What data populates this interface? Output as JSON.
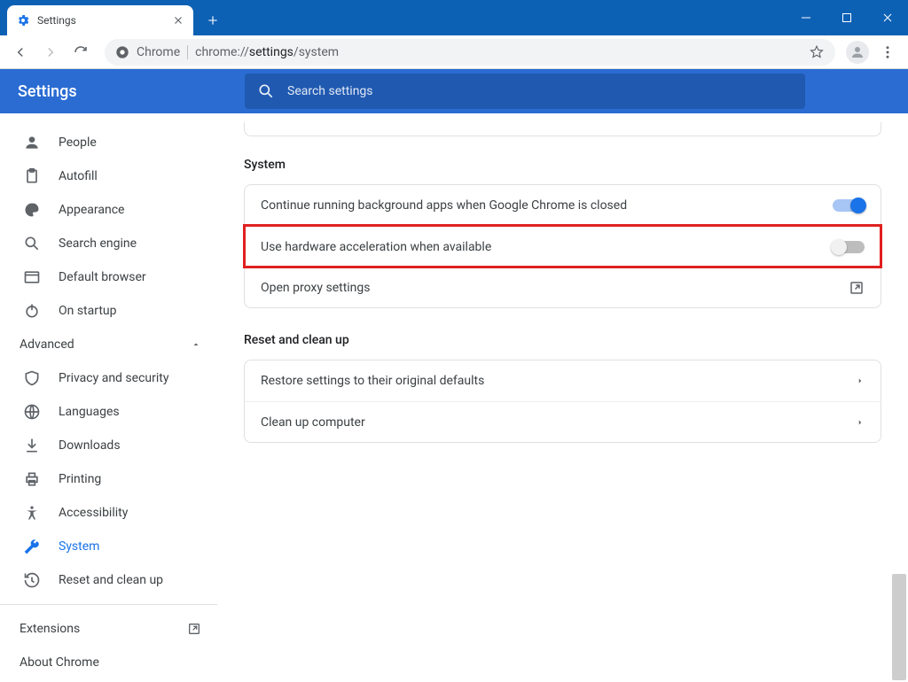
{
  "tab": {
    "title": "Settings"
  },
  "omnibox": {
    "chip": "Chrome",
    "prefix": "chrome://",
    "bold": "settings",
    "suffix": "/system"
  },
  "header": {
    "title": "Settings",
    "search_placeholder": "Search settings"
  },
  "sidebar": {
    "items": [
      {
        "icon": "person",
        "label": "People"
      },
      {
        "icon": "clipboard",
        "label": "Autofill"
      },
      {
        "icon": "palette",
        "label": "Appearance"
      },
      {
        "icon": "search",
        "label": "Search engine"
      },
      {
        "icon": "window",
        "label": "Default browser"
      },
      {
        "icon": "power",
        "label": "On startup"
      }
    ],
    "advanced_label": "Advanced",
    "adv_items": [
      {
        "icon": "shield",
        "label": "Privacy and security"
      },
      {
        "icon": "globe",
        "label": "Languages"
      },
      {
        "icon": "download",
        "label": "Downloads"
      },
      {
        "icon": "printer",
        "label": "Printing"
      },
      {
        "icon": "accessibility",
        "label": "Accessibility"
      },
      {
        "icon": "wrench",
        "label": "System",
        "selected": true
      },
      {
        "icon": "restore",
        "label": "Reset and clean up"
      }
    ],
    "extensions": "Extensions",
    "about": "About Chrome"
  },
  "main": {
    "system_title": "System",
    "rows": {
      "bg_apps": "Continue running background apps when Google Chrome is closed",
      "hw_accel": "Use hardware acceleration when available",
      "proxy": "Open proxy settings"
    },
    "reset_title": "Reset and clean up",
    "reset_rows": {
      "restore": "Restore settings to their original defaults",
      "cleanup": "Clean up computer"
    }
  }
}
